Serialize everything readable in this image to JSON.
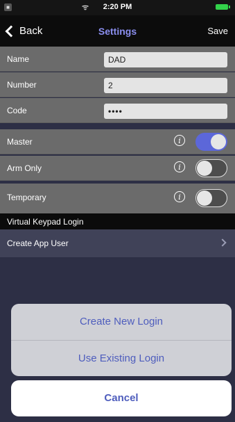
{
  "status_bar": {
    "time": "2:20 PM"
  },
  "nav": {
    "back_label": "Back",
    "title": "Settings",
    "save_label": "Save"
  },
  "form": {
    "name": {
      "label": "Name",
      "value": "DAD"
    },
    "number": {
      "label": "Number",
      "value": "2"
    },
    "code": {
      "label": "Code",
      "value": "••••"
    },
    "master": {
      "label": "Master",
      "on": true
    },
    "arm_only": {
      "label": "Arm Only",
      "on": false
    },
    "temporary": {
      "label": "Temporary",
      "on": false
    }
  },
  "section": {
    "title": "Virtual Keypad Login"
  },
  "create_app_user": {
    "label": "Create App User"
  },
  "action_sheet": {
    "create_new_login": "Create New Login",
    "use_existing_login": "Use Existing Login",
    "cancel": "Cancel"
  },
  "icons": {
    "info": "i",
    "wifi": "ᯤ"
  },
  "colors": {
    "accent": "#5c67d9",
    "title": "#8b8ff0",
    "action_text": "#4e5dbd"
  }
}
